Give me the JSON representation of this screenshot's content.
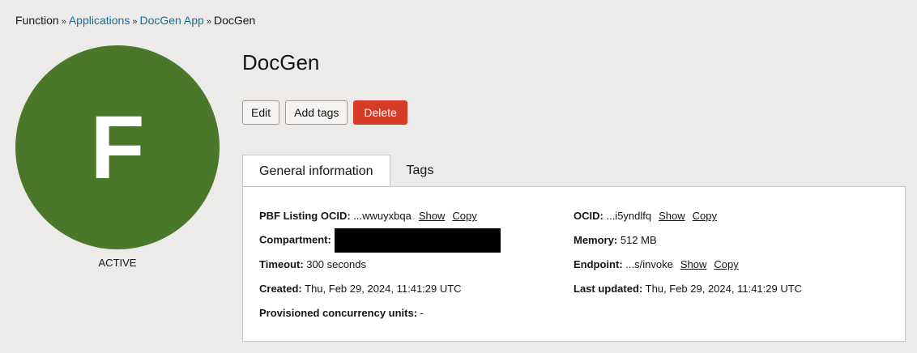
{
  "breadcrumb": {
    "items": [
      "Function",
      "Applications",
      "DocGen App",
      "DocGen"
    ]
  },
  "avatar": {
    "letter": "F",
    "status": "ACTIVE",
    "color": "#4a7729"
  },
  "header": {
    "title": "DocGen"
  },
  "actions": {
    "edit": "Edit",
    "add_tags": "Add tags",
    "delete": "Delete"
  },
  "tabs": [
    "General information",
    "Tags"
  ],
  "info": {
    "pbf_label": "PBF Listing OCID:",
    "pbf_value": "...wwuyxbqa",
    "compartment_label": "Compartment:",
    "timeout_label": "Timeout:",
    "timeout_value": "300 seconds",
    "created_label": "Created:",
    "created_value": "Thu, Feb 29, 2024, 11:41:29 UTC",
    "concurrency_label": "Provisioned concurrency units:",
    "concurrency_value": "-",
    "ocid_label": "OCID:",
    "ocid_value": "...i5yndlfq",
    "memory_label": "Memory:",
    "memory_value": "512 MB",
    "endpoint_label": "Endpoint:",
    "endpoint_value": "...s/invoke",
    "updated_label": "Last updated:",
    "updated_value": "Thu, Feb 29, 2024, 11:41:29 UTC",
    "show": "Show",
    "copy": "Copy"
  }
}
